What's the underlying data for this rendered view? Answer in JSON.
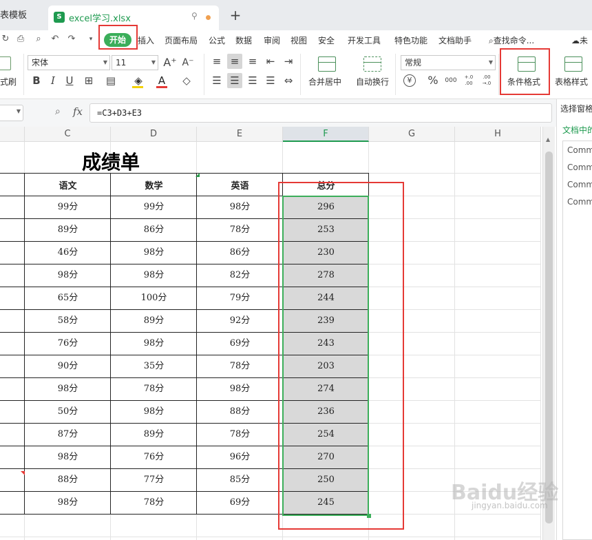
{
  "tabs": {
    "prev_label": "表模板",
    "active_label": "excel学习.xlsx",
    "file_badge": "S",
    "new_tab": "+"
  },
  "menu": {
    "items": [
      "开始",
      "插入",
      "页面布局",
      "公式",
      "数据",
      "审阅",
      "视图",
      "安全",
      "开发工具",
      "特色功能",
      "文档助手"
    ],
    "search": "查找命令...",
    "cloud": "未"
  },
  "ribbon": {
    "format_painter": "式刷",
    "font_name": "宋体",
    "font_size": "11",
    "bold": "B",
    "italic": "I",
    "underline": "U",
    "merge_center": "合并居中",
    "wrap_text": "自动换行",
    "number_format": "常规",
    "currency": "¥",
    "percent": "%",
    "thousands": "000",
    "inc_decimal": "+.0 .00",
    "dec_decimal": ".00 →.0",
    "conditional_format": "条件格式",
    "table_style": "表格样式"
  },
  "formula": {
    "fx": "fx",
    "value": "=C3+D3+E3"
  },
  "columns": [
    "C",
    "D",
    "E",
    "F",
    "G",
    "H"
  ],
  "sheet": {
    "title": "成绩单",
    "headers": [
      "语文",
      "数学",
      "英语",
      "总分"
    ],
    "rows": [
      [
        "99分",
        "99分",
        "98分",
        "296"
      ],
      [
        "89分",
        "86分",
        "78分",
        "253"
      ],
      [
        "46分",
        "98分",
        "86分",
        "230"
      ],
      [
        "98分",
        "98分",
        "82分",
        "278"
      ],
      [
        "65分",
        "100分",
        "79分",
        "244"
      ],
      [
        "58分",
        "89分",
        "92分",
        "239"
      ],
      [
        "76分",
        "98分",
        "69分",
        "243"
      ],
      [
        "90分",
        "35分",
        "78分",
        "203"
      ],
      [
        "98分",
        "78分",
        "98分",
        "274"
      ],
      [
        "50分",
        "98分",
        "88分",
        "236"
      ],
      [
        "87分",
        "89分",
        "78分",
        "254"
      ],
      [
        "98分",
        "76分",
        "96分",
        "270"
      ],
      [
        "88分",
        "77分",
        "85分",
        "250"
      ],
      [
        "98分",
        "78分",
        "69分",
        "245"
      ]
    ]
  },
  "right_pane": {
    "title": "选择窗格",
    "subtitle": "文档中的",
    "items": [
      "Comm",
      "Comm",
      "Comm",
      "Comm"
    ]
  },
  "watermark": {
    "main": "Baidu经验",
    "sub": "jingyan.baidu.com"
  },
  "colors": {
    "accent_green": "#1e9a4f",
    "start_pill": "#3bae5a",
    "highlight_red": "#e53935",
    "selected_fill": "#d9d9d9"
  }
}
